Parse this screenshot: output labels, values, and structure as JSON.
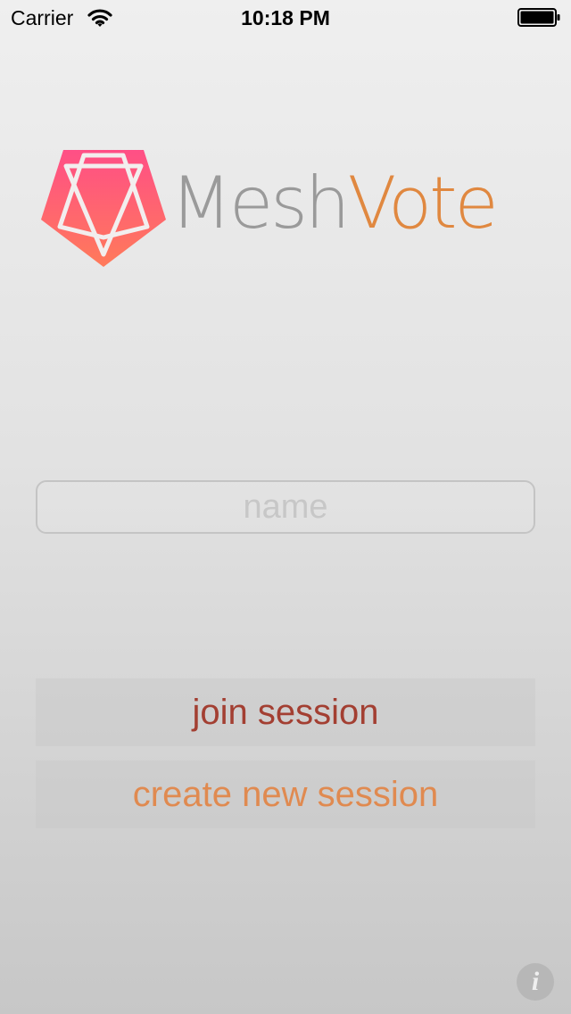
{
  "status_bar": {
    "carrier": "Carrier",
    "time": "10:18 PM",
    "wifi_icon": "wifi-icon",
    "battery_icon": "battery-icon"
  },
  "logo": {
    "word_part1": "Mesh",
    "word_part2": "Vote",
    "mark_icon": "pentagram-icon",
    "colors": {
      "mesh": "#9a9a9a",
      "vote": "#e08840",
      "mark_top": "#ff4f86",
      "mark_bottom": "#ff7a5a"
    }
  },
  "name_input": {
    "placeholder": "name",
    "value": ""
  },
  "buttons": {
    "join_label": "join session",
    "create_label": "create new session",
    "colors": {
      "join": "#a33f32",
      "create": "#e08a50"
    }
  },
  "info_button": {
    "label": "i",
    "icon": "info-icon"
  }
}
